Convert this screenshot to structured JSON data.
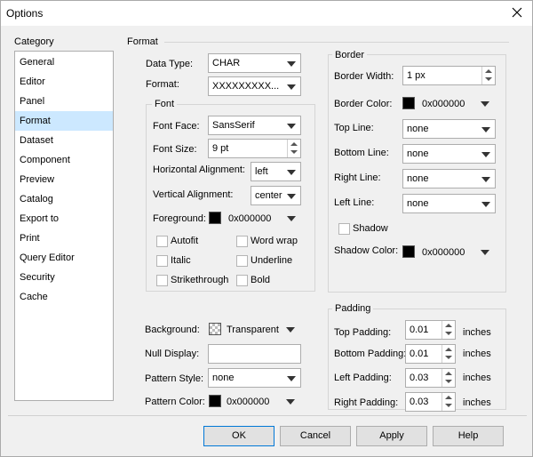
{
  "window": {
    "title": "Options"
  },
  "category": {
    "label": "Category",
    "items": [
      "General",
      "Editor",
      "Panel",
      "Format",
      "Dataset",
      "Component",
      "Preview",
      "Catalog",
      "Export to",
      "Print",
      "Query Editor",
      "Security",
      "Cache"
    ],
    "selected": "Format"
  },
  "format": {
    "section_label": "Format",
    "data_type_label": "Data Type:",
    "data_type_value": "CHAR",
    "format_label": "Format:",
    "format_value": "XXXXXXXXX..."
  },
  "font": {
    "group_label": "Font",
    "face_label": "Font Face:",
    "face_value": "SansSerif",
    "size_label": "Font Size:",
    "size_value": "9 pt",
    "halign_label": "Horizontal Alignment:",
    "halign_value": "left",
    "valign_label": "Vertical Alignment:",
    "valign_value": "center",
    "foreground_label": "Foreground:",
    "foreground_value": "0x000000",
    "autofit_label": "Autofit",
    "wordwrap_label": "Word wrap",
    "italic_label": "Italic",
    "underline_label": "Underline",
    "strikethrough_label": "Strikethrough",
    "bold_label": "Bold"
  },
  "misc": {
    "background_label": "Background:",
    "background_value": "Transparent",
    "null_display_label": "Null Display:",
    "null_display_value": "",
    "pattern_style_label": "Pattern Style:",
    "pattern_style_value": "none",
    "pattern_color_label": "Pattern Color:",
    "pattern_color_value": "0x000000"
  },
  "border": {
    "group_label": "Border",
    "width_label": "Border Width:",
    "width_value": "1 px",
    "color_label": "Border Color:",
    "color_value": "0x000000",
    "top_label": "Top Line:",
    "top_value": "none",
    "bottom_label": "Bottom Line:",
    "bottom_value": "none",
    "right_label": "Right Line:",
    "right_value": "none",
    "left_label": "Left Line:",
    "left_value": "none",
    "shadow_label": "Shadow",
    "shadow_color_label": "Shadow Color:",
    "shadow_color_value": "0x000000"
  },
  "padding": {
    "group_label": "Padding",
    "unit": "inches",
    "top_label": "Top Padding:",
    "top_value": "0.01",
    "bottom_label": "Bottom Padding:",
    "bottom_value": "0.01",
    "left_label": "Left Padding:",
    "left_value": "0.03",
    "right_label": "Right Padding:",
    "right_value": "0.03"
  },
  "buttons": {
    "ok": "OK",
    "cancel": "Cancel",
    "apply": "Apply",
    "help": "Help"
  },
  "colors": {
    "selection": "#cce8ff",
    "default_button_border": "#0078d7",
    "swatch": "#000000"
  }
}
